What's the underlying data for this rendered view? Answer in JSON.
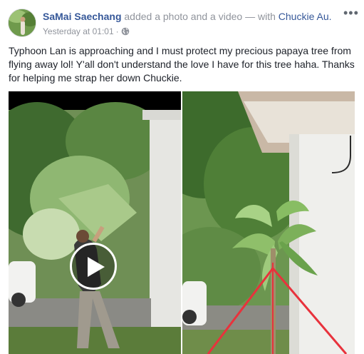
{
  "post": {
    "author": "SaMai Saechang",
    "action": " added a photo and a video — with ",
    "tagged": "Chuckie Au.",
    "timestamp": "Yesterday at 01:01",
    "separator": "·",
    "more_label": "•••",
    "caption": "Typhoon Lan is approaching and I must protect my precious papaya tree from flying away lol! Y'all don't understand the love I have for this tree haha. Thanks for helping me strap her down Chuckie."
  },
  "icons": {
    "privacy": "globe-icon",
    "video_control": "play-icon",
    "menu": "more-options-icon"
  },
  "colors": {
    "link": "#365899",
    "secondary_text": "#90949c",
    "body_text": "#1d2129",
    "tie_down_strap": "#e8323c"
  }
}
